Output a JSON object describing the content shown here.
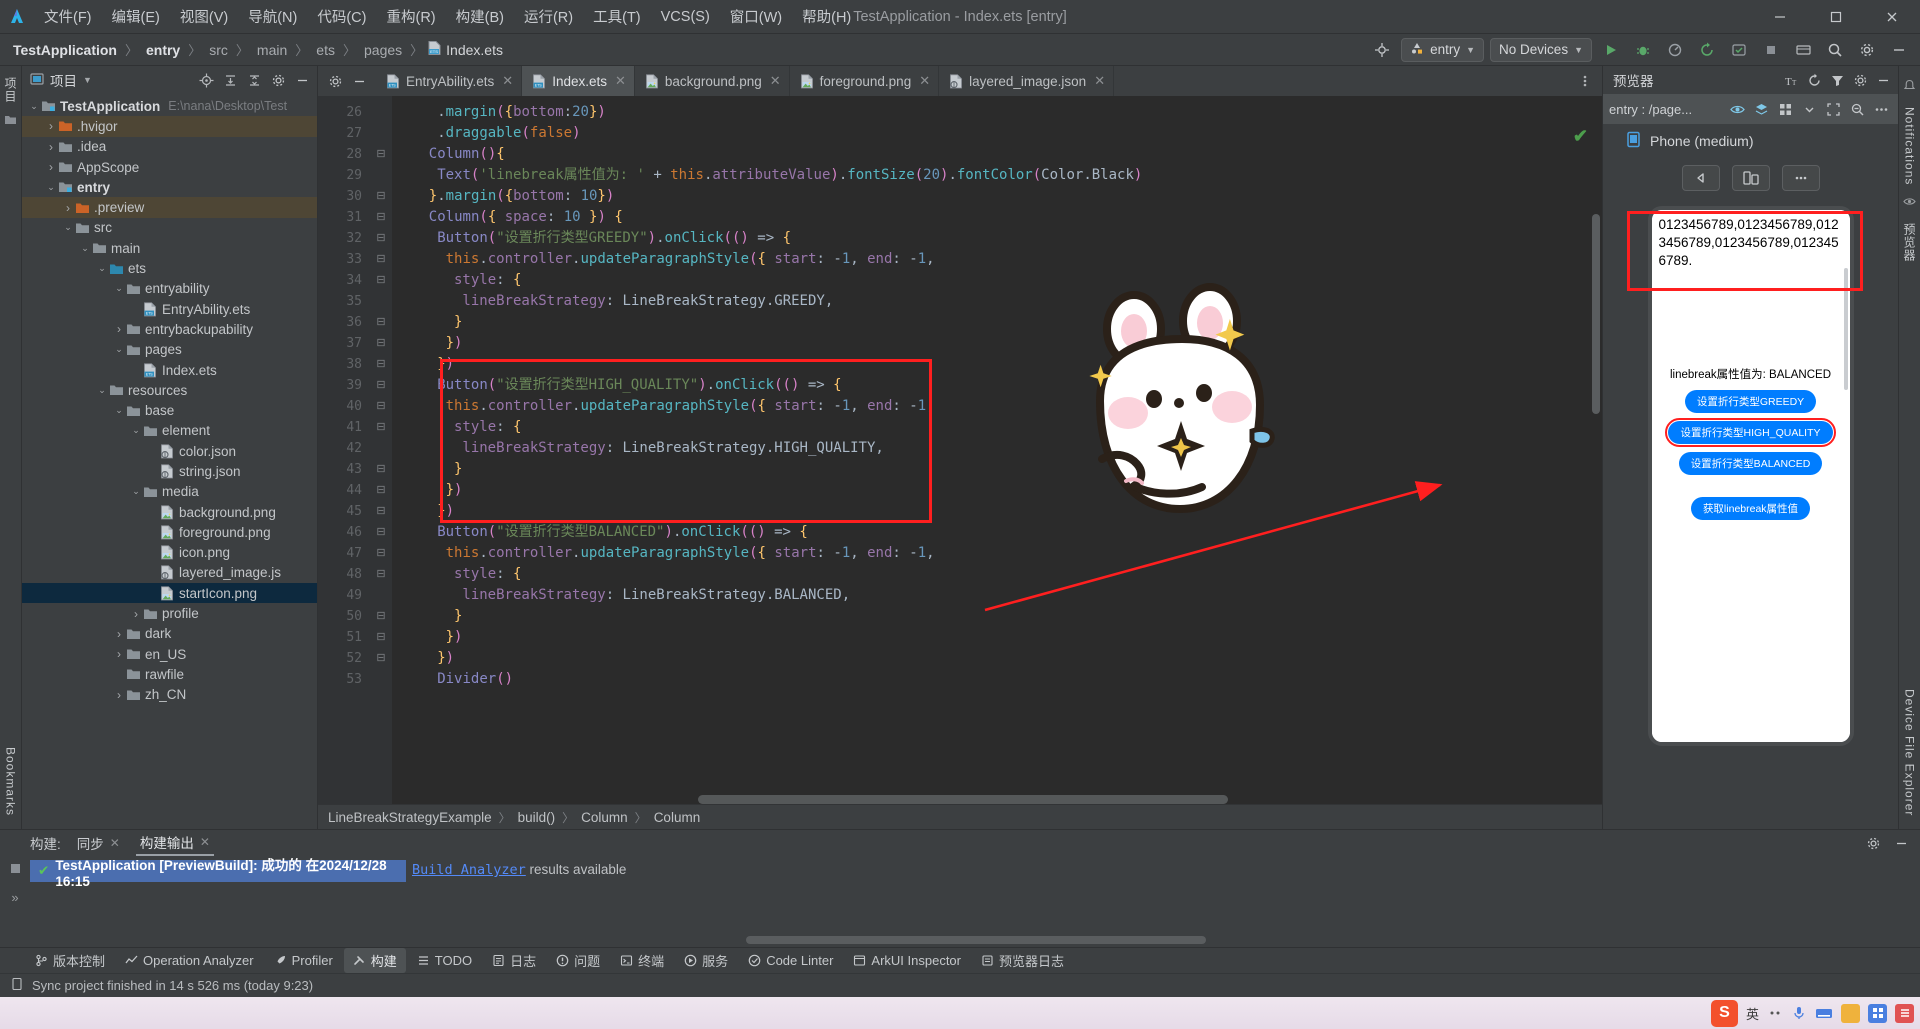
{
  "window": {
    "title": "TestApplication - Index.ets [entry]",
    "app_icon": "deveco-logo-icon",
    "minimize": "–",
    "maximize": "□",
    "close": "✕"
  },
  "menu": [
    {
      "label": "文件(F)",
      "name": "menu-file"
    },
    {
      "label": "编辑(E)",
      "name": "menu-edit"
    },
    {
      "label": "视图(V)",
      "name": "menu-view"
    },
    {
      "label": "导航(N)",
      "name": "menu-navigate"
    },
    {
      "label": "代码(C)",
      "name": "menu-code"
    },
    {
      "label": "重构(R)",
      "name": "menu-refactor"
    },
    {
      "label": "构建(B)",
      "name": "menu-build"
    },
    {
      "label": "运行(R)",
      "name": "menu-run"
    },
    {
      "label": "工具(T)",
      "name": "menu-tools"
    },
    {
      "label": "VCS(S)",
      "name": "menu-vcs"
    },
    {
      "label": "窗口(W)",
      "name": "menu-window"
    },
    {
      "label": "帮助(H)",
      "name": "menu-help"
    }
  ],
  "breadcrumb": {
    "items": [
      "TestApplication",
      "entry",
      "src",
      "main",
      "ets",
      "pages"
    ],
    "file": "Index.ets",
    "separator": "〉"
  },
  "toolbar": {
    "target_icon": "target-icon",
    "run_config": "entry",
    "device": "No Devices",
    "run_icon": "run-icon",
    "debug_icon": "debug-icon",
    "profile_icon": "profile-icon",
    "rerun_icon": "rerun-icon",
    "coverage_icon": "coverage-icon",
    "stop_icon": "stop-icon",
    "device_manager_icon": "device-manager-icon",
    "search_icon": "search-icon",
    "settings_icon": "gear-icon",
    "notifications_icon": "bell-icon"
  },
  "project_panel": {
    "title": "项目",
    "title_icon": "project-icon",
    "caret": "▾",
    "icons": [
      "locate-icon",
      "expand-all-icon",
      "collapse-all-icon",
      "gear-icon",
      "minimize-icon"
    ],
    "tree": [
      {
        "label": "TestApplication",
        "path": "E:\\nana\\Desktop\\Test",
        "depth": 0,
        "arrow": "⌄",
        "icon": "module-folder-icon",
        "bold": true,
        "state": "normal"
      },
      {
        "label": ".hvigor",
        "depth": 1,
        "arrow": "›",
        "icon": "orange-folder-icon",
        "state": "hl"
      },
      {
        "label": ".idea",
        "depth": 1,
        "arrow": "›",
        "icon": "folder-icon",
        "state": "normal"
      },
      {
        "label": "AppScope",
        "depth": 1,
        "arrow": "›",
        "icon": "folder-icon",
        "state": "normal"
      },
      {
        "label": "entry",
        "depth": 1,
        "arrow": "⌄",
        "icon": "module-folder-icon",
        "bold": true,
        "state": "normal"
      },
      {
        "label": ".preview",
        "depth": 2,
        "arrow": "›",
        "icon": "orange-folder-icon",
        "state": "hl"
      },
      {
        "label": "src",
        "depth": 2,
        "arrow": "⌄",
        "icon": "folder-icon",
        "state": "normal"
      },
      {
        "label": "main",
        "depth": 3,
        "arrow": "⌄",
        "icon": "folder-icon",
        "state": "normal"
      },
      {
        "label": "ets",
        "depth": 4,
        "arrow": "⌄",
        "icon": "source-folder-icon",
        "state": "normal"
      },
      {
        "label": "entryability",
        "depth": 5,
        "arrow": "⌄",
        "icon": "folder-icon",
        "state": "normal"
      },
      {
        "label": "EntryAbility.ets",
        "depth": 6,
        "arrow": "",
        "icon": "ets-file-icon",
        "state": "normal"
      },
      {
        "label": "entrybackupability",
        "depth": 5,
        "arrow": "›",
        "icon": "folder-icon",
        "state": "normal"
      },
      {
        "label": "pages",
        "depth": 5,
        "arrow": "⌄",
        "icon": "folder-icon",
        "state": "normal"
      },
      {
        "label": "Index.ets",
        "depth": 6,
        "arrow": "",
        "icon": "ets-file-icon",
        "state": "normal"
      },
      {
        "label": "resources",
        "depth": 4,
        "arrow": "⌄",
        "icon": "folder-icon",
        "state": "normal"
      },
      {
        "label": "base",
        "depth": 5,
        "arrow": "⌄",
        "icon": "folder-icon",
        "state": "normal"
      },
      {
        "label": "element",
        "depth": 6,
        "arrow": "⌄",
        "icon": "folder-icon",
        "state": "normal"
      },
      {
        "label": "color.json",
        "depth": 7,
        "arrow": "",
        "icon": "json-file-icon",
        "state": "normal"
      },
      {
        "label": "string.json",
        "depth": 7,
        "arrow": "",
        "icon": "json-file-icon",
        "state": "normal"
      },
      {
        "label": "media",
        "depth": 6,
        "arrow": "⌄",
        "icon": "folder-icon",
        "state": "normal"
      },
      {
        "label": "background.png",
        "depth": 7,
        "arrow": "",
        "icon": "image-file-icon",
        "state": "normal"
      },
      {
        "label": "foreground.png",
        "depth": 7,
        "arrow": "",
        "icon": "image-file-icon",
        "state": "normal"
      },
      {
        "label": "icon.png",
        "depth": 7,
        "arrow": "",
        "icon": "image-file-icon",
        "state": "normal"
      },
      {
        "label": "layered_image.js",
        "depth": 7,
        "arrow": "",
        "icon": "json-file-icon",
        "state": "normal"
      },
      {
        "label": "startIcon.png",
        "depth": 7,
        "arrow": "",
        "icon": "image-file-icon",
        "state": "sel"
      },
      {
        "label": "profile",
        "depth": 6,
        "arrow": "›",
        "icon": "folder-icon",
        "state": "normal"
      },
      {
        "label": "dark",
        "depth": 5,
        "arrow": "›",
        "icon": "folder-icon",
        "state": "normal"
      },
      {
        "label": "en_US",
        "depth": 5,
        "arrow": "›",
        "icon": "folder-icon",
        "state": "normal"
      },
      {
        "label": "rawfile",
        "depth": 5,
        "arrow": "",
        "icon": "folder-icon",
        "state": "normal"
      },
      {
        "label": "zh_CN",
        "depth": 5,
        "arrow": "›",
        "icon": "folder-icon",
        "state": "normal"
      }
    ]
  },
  "editor": {
    "tabs": [
      {
        "label": "EntryAbility.ets",
        "icon": "ets-file-icon",
        "active": false,
        "close": "✕"
      },
      {
        "label": "Index.ets",
        "icon": "ets-file-icon",
        "active": true,
        "close": "✕"
      },
      {
        "label": "background.png",
        "icon": "image-file-icon",
        "active": false,
        "close": "✕"
      },
      {
        "label": "foreground.png",
        "icon": "image-file-icon",
        "active": false,
        "close": "✕"
      },
      {
        "label": "layered_image.json",
        "icon": "json-file-icon",
        "active": false,
        "close": "✕"
      }
    ],
    "tabs_overflow_icon": "more-vertical-icon",
    "first_line_number": 26,
    "lines": [
      {
        "n": 26,
        "fold": "",
        "text": ".margin({bottom:20})"
      },
      {
        "n": 27,
        "fold": "",
        "text": ".draggable(false)"
      },
      {
        "n": 28,
        "fold": "⊟",
        "text": "Column(){"
      },
      {
        "n": 29,
        "fold": "",
        "text": "Text('linebreak属性值为: ' + this.attributeValue).fontSize(20).fontColor(Color.Black)"
      },
      {
        "n": 30,
        "fold": "⊟",
        "text": "}.margin({bottom: 10})"
      },
      {
        "n": 31,
        "fold": "⊟",
        "text": "Column({ space: 10 }) {"
      },
      {
        "n": 32,
        "fold": "⊟",
        "text": "Button(\"设置折行类型GREEDY\").onClick(() => {"
      },
      {
        "n": 33,
        "fold": "⊟",
        "text": "this.controller.updateParagraphStyle({ start: -1, end: -1,"
      },
      {
        "n": 34,
        "fold": "⊟",
        "text": "style: {"
      },
      {
        "n": 35,
        "fold": "",
        "text": "lineBreakStrategy: LineBreakStrategy.GREEDY,"
      },
      {
        "n": 36,
        "fold": "⊟",
        "text": "}"
      },
      {
        "n": 37,
        "fold": "⊟",
        "text": "})"
      },
      {
        "n": 38,
        "fold": "⊟",
        "text": "})"
      },
      {
        "n": 39,
        "fold": "⊟",
        "text": "Button(\"设置折行类型HIGH_QUALITY\").onClick(() => {"
      },
      {
        "n": 40,
        "fold": "⊟",
        "text": "this.controller.updateParagraphStyle({ start: -1, end: -1,"
      },
      {
        "n": 41,
        "fold": "⊟",
        "text": "style: {"
      },
      {
        "n": 42,
        "fold": "",
        "text": "lineBreakStrategy: LineBreakStrategy.HIGH_QUALITY,"
      },
      {
        "n": 43,
        "fold": "⊟",
        "text": "}"
      },
      {
        "n": 44,
        "fold": "⊟",
        "text": "})"
      },
      {
        "n": 45,
        "fold": "⊟",
        "text": "})"
      },
      {
        "n": 46,
        "fold": "⊟",
        "text": "Button(\"设置折行类型BALANCED\").onClick(() => {"
      },
      {
        "n": 47,
        "fold": "⊟",
        "text": "this.controller.updateParagraphStyle({ start: -1, end: -1,"
      },
      {
        "n": 48,
        "fold": "⊟",
        "text": "style: {"
      },
      {
        "n": 49,
        "fold": "",
        "text": "lineBreakStrategy: LineBreakStrategy.BALANCED,"
      },
      {
        "n": 50,
        "fold": "⊟",
        "text": "}"
      },
      {
        "n": 51,
        "fold": "⊟",
        "text": "})"
      },
      {
        "n": 52,
        "fold": "⊟",
        "text": "})"
      },
      {
        "n": 53,
        "fold": "",
        "text": "Divider()"
      }
    ],
    "inspection_ok_icon": "check-icon",
    "bulb_icon": "lightbulb-icon",
    "bottom_breadcrumb": [
      "LineBreakStrategyExample",
      "build()",
      "Column",
      "Column"
    ]
  },
  "preview": {
    "title": "预览器",
    "head_icons": [
      "font-size-icon",
      "refresh-icon",
      "filter-icon",
      "gear-icon",
      "minimize-icon"
    ],
    "selected_file": "entry : /page...",
    "sub_icons": [
      "eye-icon",
      "layers-icon",
      "grid-icon",
      "chevron-down-icon",
      "fullscreen-icon",
      "zoom-out-icon",
      "more-horizontal-icon"
    ],
    "device_icon": "phone-icon",
    "device_name": "Phone (medium)",
    "ctrl_buttons": [
      "rotate-left-icon",
      "rotate-device-icon",
      "more-horizontal-icon"
    ],
    "phone_text": "0123456789,0123456789,0123456789,0123456789,0123456789.",
    "attribute_line": "linebreak属性值为: BALANCED",
    "buttons": [
      {
        "label": "设置折行类型GREEDY",
        "highlighted": false
      },
      {
        "label": "设置折行类型HIGH_QUALITY",
        "highlighted": true
      },
      {
        "label": "设置折行类型BALANCED",
        "highlighted": false
      },
      {
        "label": "获取linebreak属性值",
        "highlighted": false
      }
    ]
  },
  "right_rail": {
    "items": [
      "Notifications",
      "预览器",
      "Device File Explorer"
    ]
  },
  "left_rail": {
    "top": "项目",
    "bottom": "Bookmarks"
  },
  "build_panel": {
    "label": "构建:",
    "tabs": [
      {
        "label": "同步",
        "close": "✕",
        "active": false
      },
      {
        "label": "构建输出",
        "close": "✕",
        "active": true
      }
    ],
    "head_icons": [
      "gear-icon",
      "minimize-icon"
    ],
    "result_row": {
      "status_icon": "check-icon",
      "text": "TestApplication [PreviewBuild]: 成功的 在2024/12/28 16:15"
    },
    "output": {
      "link": "Build Analyzer",
      "text": " results available"
    }
  },
  "status_tools": [
    {
      "label": "版本控制",
      "icon": "branch-icon",
      "active": false
    },
    {
      "label": "Operation Analyzer",
      "icon": "chart-icon",
      "active": false
    },
    {
      "label": "Profiler",
      "icon": "rocket-icon",
      "active": false
    },
    {
      "label": "构建",
      "icon": "hammer-icon",
      "active": true
    },
    {
      "label": "TODO",
      "icon": "list-icon",
      "active": false
    },
    {
      "label": "日志",
      "icon": "log-icon",
      "active": false
    },
    {
      "label": "问题",
      "icon": "warning-icon",
      "active": false
    },
    {
      "label": "终端",
      "icon": "terminal-icon",
      "active": false
    },
    {
      "label": "服务",
      "icon": "services-icon",
      "active": false
    },
    {
      "label": "Code Linter",
      "icon": "linter-icon",
      "active": false
    },
    {
      "label": "ArkUI Inspector",
      "icon": "inspector-icon",
      "active": false
    },
    {
      "label": "预览器日志",
      "icon": "preview-log-icon",
      "active": false
    }
  ],
  "statusbar": {
    "icon": "device-icon",
    "message": "Sync project finished in 14 s 526 ms (today 9:23)"
  },
  "taskbar": {
    "ime_logo": "S",
    "ime_lang": "英",
    "icons": [
      "dot-icon",
      "mic-icon",
      "keyboard-icon",
      "box-icon",
      "grid-icon",
      "menu-icon"
    ]
  },
  "colors": {
    "accent_blue": "#007dff",
    "annotation_red": "#ff1f1f",
    "selection_blue": "#4b6eaf",
    "success_green": "#4c9e4c",
    "ide_bg": "#3c3f41",
    "editor_bg": "#2b2b2b"
  }
}
